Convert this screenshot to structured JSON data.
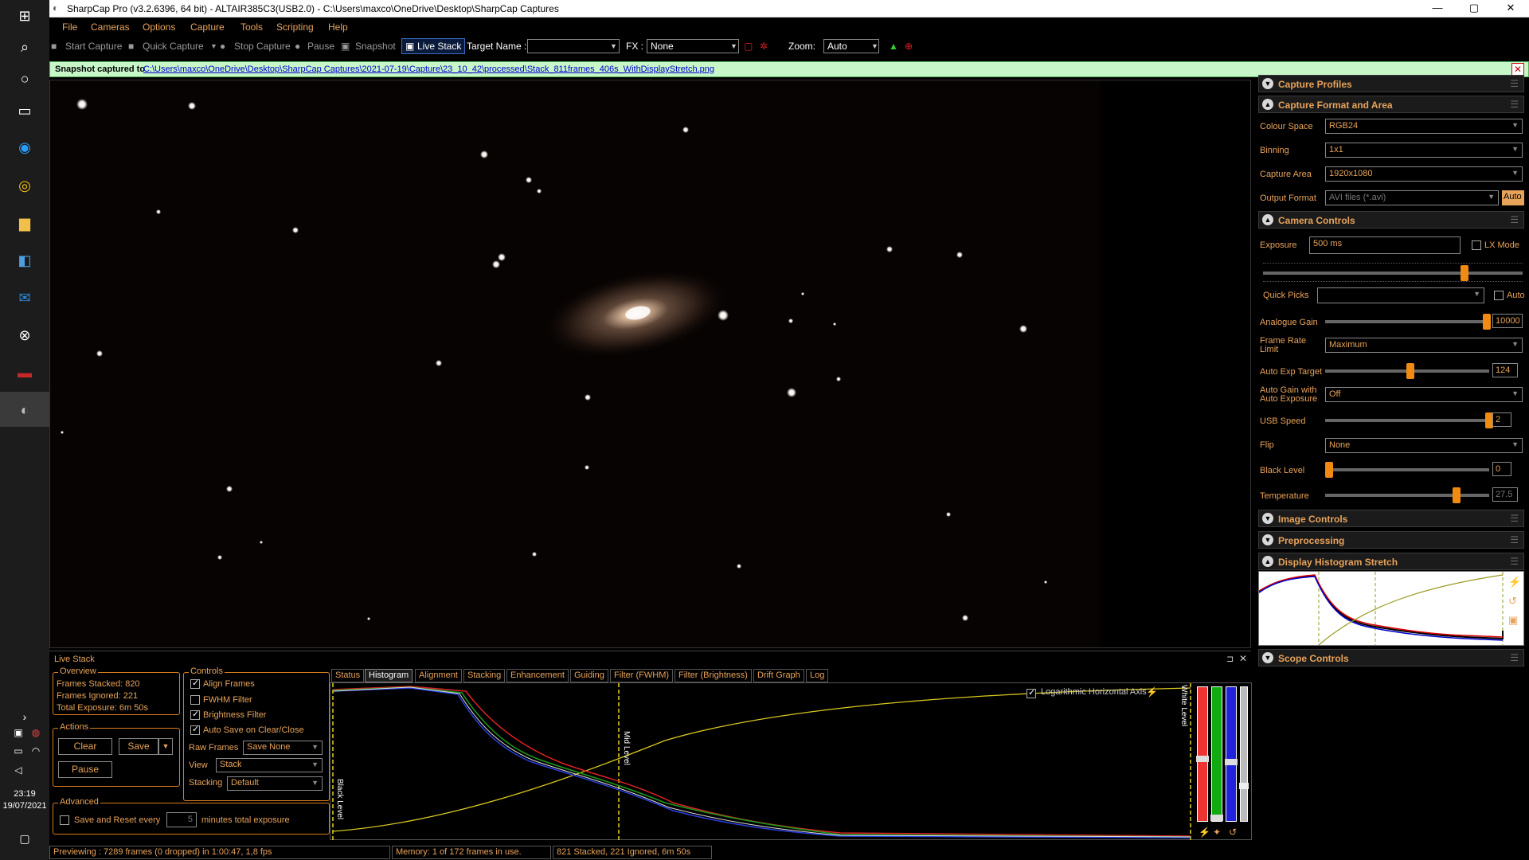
{
  "window": {
    "title": "SharpCap Pro (v3.2.6396, 64 bit) - ALTAIR385C3(USB2.0) - C:\\Users\\maxco\\OneDrive\\Desktop\\SharpCap Captures"
  },
  "taskbar": {
    "time": "23:19",
    "date": "19/07/2021"
  },
  "menu": [
    "File",
    "Cameras",
    "Options",
    "Capture",
    "Tools",
    "Scripting",
    "Help"
  ],
  "toolbar": {
    "start_capture": "Start Capture",
    "quick_capture": "Quick Capture",
    "stop_capture": "Stop Capture",
    "pause": "Pause",
    "snapshot": "Snapshot",
    "live_stack": "Live Stack",
    "target_name_label": "Target Name :",
    "target_name_value": "",
    "fx_label": "FX :",
    "fx_value": "None",
    "zoom_label": "Zoom:",
    "zoom_value": "Auto"
  },
  "notification": {
    "label": "Snapshot captured to",
    "path": "C:\\Users\\maxco\\OneDrive\\Desktop\\SharpCap Captures\\2021-07-19\\Capture\\23_10_42\\processed\\Stack_811frames_406s_WithDisplayStretch.png"
  },
  "right_panel": {
    "capture_profiles": "Capture Profiles",
    "capture_format": {
      "title": "Capture Format and Area",
      "colour_space_label": "Colour Space",
      "colour_space": "RGB24",
      "binning_label": "Binning",
      "binning": "1x1",
      "capture_area_label": "Capture Area",
      "capture_area": "1920x1080",
      "output_format_label": "Output Format",
      "output_format": "AVI files (*.avi)",
      "auto_label": "Auto"
    },
    "camera_controls": {
      "title": "Camera Controls",
      "exposure_label": "Exposure",
      "exposure": "500 ms",
      "lx_mode": "LX Mode",
      "quick_picks_label": "Quick Picks",
      "quick_picks": "",
      "auto_label": "Auto",
      "analogue_gain_label": "Analogue Gain",
      "analogue_gain": "10000",
      "frame_rate_label": "Frame Rate Limit",
      "frame_rate": "Maximum",
      "auto_exp_target_label": "Auto Exp Target",
      "auto_exp_target": "124",
      "auto_gain_label": "Auto Gain with Auto Exposure",
      "auto_gain": "Off",
      "usb_speed_label": "USB Speed",
      "usb_speed": "2",
      "flip_label": "Flip",
      "flip": "None",
      "black_level_label": "Black Level",
      "black_level": "0",
      "temperature_label": "Temperature",
      "temperature": "27.5"
    },
    "image_controls": "Image Controls",
    "preprocessing": "Preprocessing",
    "display_histogram": "Display Histogram Stretch",
    "scope_controls": "Scope Controls"
  },
  "live_stack": {
    "title": "Live Stack",
    "overview": {
      "title": "Overview",
      "frames_stacked": "Frames Stacked:  820",
      "frames_ignored": "Frames Ignored:  221",
      "total_exposure": "Total Exposure:   6m 50s"
    },
    "actions": {
      "title": "Actions",
      "clear": "Clear",
      "save": "Save",
      "pause": "Pause"
    },
    "controls": {
      "title": "Controls",
      "align_frames": "Align Frames",
      "fwhm_filter": "FWHM Filter",
      "brightness_filter": "Brightness Filter",
      "auto_save": "Auto Save on Clear/Close",
      "raw_frames_label": "Raw Frames",
      "raw_frames": "Save None",
      "view_label": "View",
      "view": "Stack",
      "stacking_label": "Stacking",
      "stacking": "Default"
    },
    "advanced": {
      "title": "Advanced",
      "save_reset": "Save and Reset every",
      "minutes_value": "5",
      "minutes_label": "minutes total exposure"
    },
    "tabs": [
      "Status",
      "Histogram",
      "Alignment",
      "Stacking",
      "Enhancement",
      "Guiding",
      "Filter (FWHM)",
      "Filter (Brightness)",
      "Drift Graph",
      "Log"
    ],
    "histogram": {
      "log_axis": "Logarithmic Horizontal Axis",
      "black_level": "Black Level",
      "mid_level": "Mid Level",
      "white_level": "White Level"
    }
  },
  "statusbar": {
    "preview": "Previewing : 7289 frames (0 dropped) in 1:00:47, 1,8 fps",
    "memory": "Memory: 1 of 172 frames in use.",
    "stacked": "821 Stacked, 221 Ignored, 6m 50s"
  }
}
